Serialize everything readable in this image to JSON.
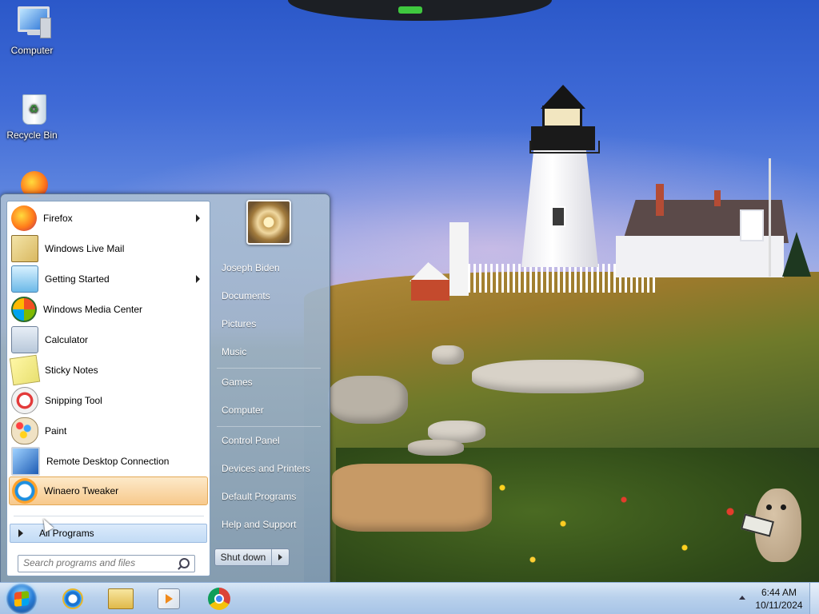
{
  "desktop": {
    "icons": [
      {
        "label": "Computer",
        "icon": "computer-icon"
      },
      {
        "label": "Recycle Bin",
        "icon": "recycle-bin-icon"
      },
      {
        "label": "",
        "icon": "firefox-icon"
      }
    ]
  },
  "start_menu": {
    "programs": [
      {
        "label": "Firefox",
        "icon": "firefox-icon",
        "has_submenu": true
      },
      {
        "label": "Windows Live Mail",
        "icon": "mail-icon",
        "has_submenu": false
      },
      {
        "label": "Getting Started",
        "icon": "getting-started-icon",
        "has_submenu": true
      },
      {
        "label": "Windows Media Center",
        "icon": "media-center-icon",
        "has_submenu": false
      },
      {
        "label": "Calculator",
        "icon": "calculator-icon",
        "has_submenu": false
      },
      {
        "label": "Sticky Notes",
        "icon": "sticky-notes-icon",
        "has_submenu": false
      },
      {
        "label": "Snipping Tool",
        "icon": "snipping-tool-icon",
        "has_submenu": false
      },
      {
        "label": "Paint",
        "icon": "paint-icon",
        "has_submenu": false
      },
      {
        "label": "Remote Desktop Connection",
        "icon": "remote-desktop-icon",
        "has_submenu": false
      },
      {
        "label": "Winaero Tweaker",
        "icon": "winaero-tweaker-icon",
        "has_submenu": false,
        "highlighted": true
      }
    ],
    "all_programs": "All Programs",
    "search_placeholder": "Search programs and files",
    "right_items": [
      "Joseph Biden",
      "Documents",
      "Pictures",
      "Music",
      "Games",
      "Computer",
      "Control Panel",
      "Devices and Printers",
      "Default Programs",
      "Help and Support"
    ],
    "shutdown_label": "Shut down"
  },
  "taskbar": {
    "pinned": [
      "internet-explorer-icon",
      "windows-explorer-icon",
      "media-player-icon",
      "chrome-icon"
    ],
    "time": "6:44 AM",
    "date": "10/11/2024"
  },
  "colors": {
    "highlight": "#f7c98c",
    "taskbar": "#b9d1ec",
    "start_menu": "#a6bcd4"
  }
}
